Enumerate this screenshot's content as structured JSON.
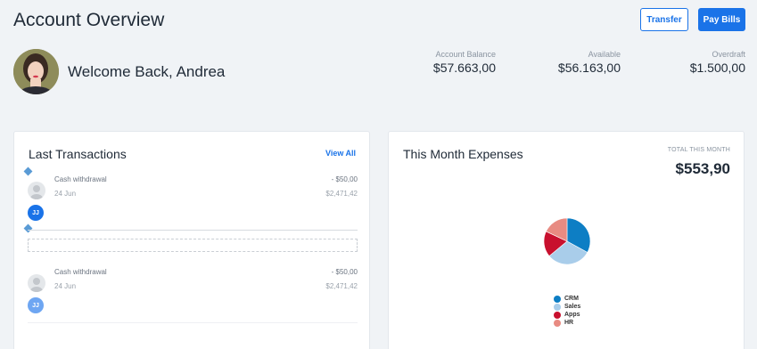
{
  "header": {
    "title": "Account Overview",
    "transfer_label": "Transfer",
    "pay_bills_label": "Pay Bills"
  },
  "profile": {
    "welcome": "Welcome Back, Andrea"
  },
  "stats": {
    "balance_label": "Account Balance",
    "balance_value": "$57.663,00",
    "available_label": "Available",
    "available_value": "$56.163,00",
    "overdraft_label": "Overdraft",
    "overdraft_value": "$1.500,00"
  },
  "transactions": {
    "title": "Last Transactions",
    "view_all": "View All",
    "items": [
      {
        "name": "Cash withdrawal",
        "date": "24 Jun",
        "amount": "- $50,00",
        "balance": "$2,471,42",
        "initials": "JJ"
      },
      {
        "name": "Cash withdrawal",
        "date": "24 Jun",
        "amount": "- $50,00",
        "balance": "$2,471,42",
        "initials": "JJ"
      }
    ]
  },
  "expenses": {
    "title": "This Month Expenses",
    "total_label": "TOTAL THIS MONTH",
    "total_value": "$553,90",
    "legend": [
      {
        "label": "CRM",
        "color": "#0d7ec4"
      },
      {
        "label": "Sales",
        "color": "#a9cdea"
      },
      {
        "label": "Apps",
        "color": "#c8102e"
      },
      {
        "label": "HR",
        "color": "#e88b82"
      }
    ]
  },
  "chart_data": {
    "type": "pie",
    "categories": [
      "CRM",
      "Sales",
      "Apps",
      "HR"
    ],
    "values": [
      33,
      31,
      18,
      18
    ],
    "colors": [
      "#0d7ec4",
      "#a9cdea",
      "#c8102e",
      "#e88b82"
    ]
  }
}
